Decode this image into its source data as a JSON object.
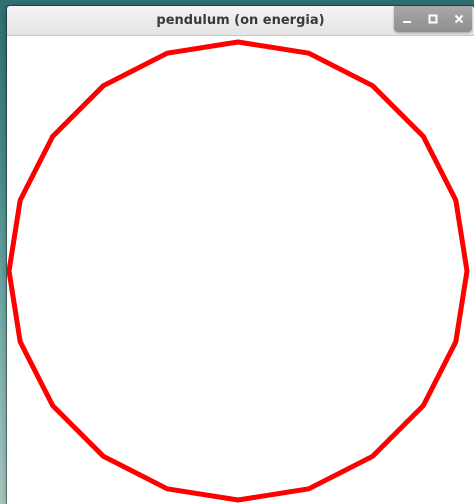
{
  "window": {
    "title": "pendulum (on energia)"
  },
  "controls": {
    "minimize_icon": "minimize-icon",
    "maximize_icon": "maximize-icon",
    "close_icon": "close-icon"
  },
  "drawing": {
    "shape": "polygon",
    "sides": 20,
    "stroke_color": "#ff0000",
    "fill": "none",
    "background": "#ffffff"
  }
}
